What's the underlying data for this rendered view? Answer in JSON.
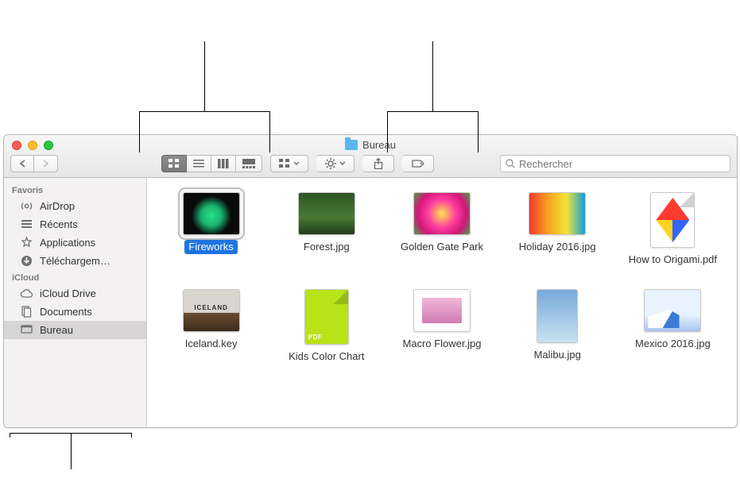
{
  "window": {
    "title": "Bureau"
  },
  "search": {
    "placeholder": "Rechercher"
  },
  "sidebar": {
    "sections": [
      {
        "heading": "Favoris",
        "items": [
          {
            "label": "AirDrop",
            "icon": "airdrop"
          },
          {
            "label": "Récents",
            "icon": "recents"
          },
          {
            "label": "Applications",
            "icon": "applications"
          },
          {
            "label": "Téléchargem…",
            "icon": "downloads"
          }
        ]
      },
      {
        "heading": "iCloud",
        "items": [
          {
            "label": "iCloud Drive",
            "icon": "cloud"
          },
          {
            "label": "Documents",
            "icon": "documents"
          },
          {
            "label": "Bureau",
            "icon": "desktop",
            "selected": true
          }
        ]
      }
    ]
  },
  "files": [
    {
      "label": "Fireworks",
      "thumb": "th-fireworks",
      "selected": true
    },
    {
      "label": "Forest.jpg",
      "thumb": "th-forest"
    },
    {
      "label": "Golden Gate Park",
      "thumb": "th-golden"
    },
    {
      "label": "Holiday 2016.jpg",
      "thumb": "th-holiday"
    },
    {
      "label": "How to Origami.pdf",
      "thumb": "th-origami",
      "pdf": true,
      "pdfColor": "#fff"
    },
    {
      "label": "Iceland.key",
      "thumb": "th-iceland"
    },
    {
      "label": "Kids Color Chart",
      "thumb": "th-kids",
      "pdf": true,
      "pdfColor": "#b7e317"
    },
    {
      "label": "Macro Flower.jpg",
      "thumb": "th-macro"
    },
    {
      "label": "Malibu.jpg",
      "thumb": "th-malibu",
      "narrow": true
    },
    {
      "label": "Mexico 2016.jpg",
      "thumb": "th-mexico"
    }
  ]
}
